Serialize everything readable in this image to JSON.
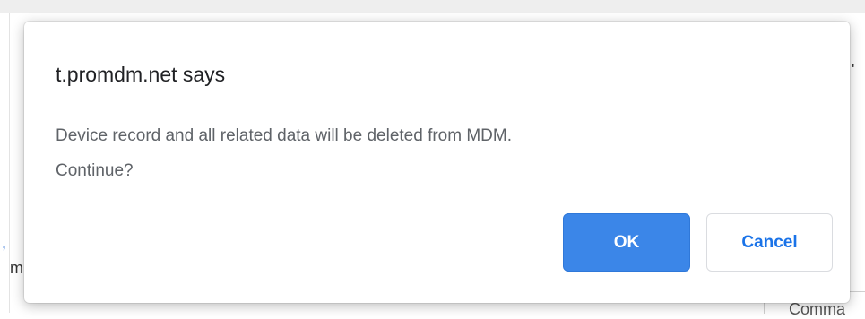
{
  "background": {
    "left_fragment_1": ",",
    "left_fragment_2": "m",
    "right_fragment": "Comma",
    "right_marker": "'"
  },
  "dialog": {
    "title": "t.promdm.net says",
    "message_line1": "Device record and all related data will be deleted from MDM.",
    "message_line2": "Continue?",
    "ok_label": "OK",
    "cancel_label": "Cancel"
  },
  "colors": {
    "ok_button": "#3b86e8",
    "cancel_text": "#1a73e8",
    "message_text": "#5f6368"
  }
}
